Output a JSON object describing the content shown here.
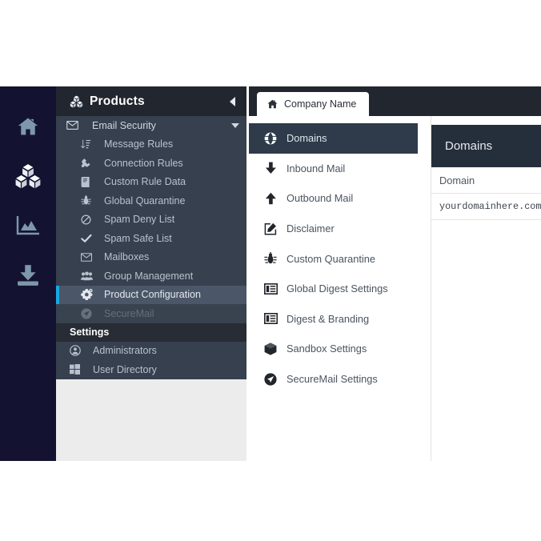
{
  "rail": {
    "items": [
      {
        "name": "home-icon",
        "label": "Home",
        "active": false
      },
      {
        "name": "products-icon",
        "label": "Products",
        "active": true
      },
      {
        "name": "reports-icon",
        "label": "Reports",
        "active": false
      },
      {
        "name": "downloads-icon",
        "label": "Downloads",
        "active": false
      }
    ]
  },
  "products": {
    "title": "Products",
    "collapse_label": "Collapse",
    "group": {
      "label": "Email Security",
      "icon": "envelope-icon",
      "expanded": true
    },
    "items": [
      {
        "label": "Message Rules",
        "icon": "sort-list-icon",
        "state": "normal"
      },
      {
        "label": "Connection Rules",
        "icon": "plug-icon",
        "state": "normal"
      },
      {
        "label": "Custom Rule Data",
        "icon": "book-icon",
        "state": "normal"
      },
      {
        "label": "Global Quarantine",
        "icon": "bug-icon",
        "state": "normal"
      },
      {
        "label": "Spam Deny List",
        "icon": "ban-icon",
        "state": "normal"
      },
      {
        "label": "Spam Safe List",
        "icon": "check-icon",
        "state": "normal"
      },
      {
        "label": "Mailboxes",
        "icon": "envelope-icon",
        "state": "normal"
      },
      {
        "label": "Group Management",
        "icon": "users-icon",
        "state": "normal"
      },
      {
        "label": "Product Configuration",
        "icon": "gears-icon",
        "state": "selected"
      },
      {
        "label": "SecureMail",
        "icon": "paper-plane-icon",
        "state": "disabled"
      }
    ],
    "settings_section": {
      "label": "Settings"
    },
    "settings_items": [
      {
        "label": "Administrators",
        "icon": "user-circle-icon",
        "state": "normal"
      },
      {
        "label": "User Directory",
        "icon": "windows-icon",
        "state": "normal"
      }
    ]
  },
  "tabbar": {
    "tabs": [
      {
        "label": "Company Name",
        "icon": "home-icon",
        "active": true
      }
    ]
  },
  "menu": {
    "items": [
      {
        "label": "Domains",
        "icon": "globe-icon",
        "active": true
      },
      {
        "label": "Inbound Mail",
        "icon": "arrow-down-icon",
        "active": false
      },
      {
        "label": "Outbound Mail",
        "icon": "arrow-up-icon",
        "active": false
      },
      {
        "label": "Disclaimer",
        "icon": "edit-square-icon",
        "active": false
      },
      {
        "label": "Custom Quarantine",
        "icon": "bug-icon",
        "active": false
      },
      {
        "label": "Global Digest Settings",
        "icon": "list-panel-icon",
        "active": false
      },
      {
        "label": "Digest & Branding",
        "icon": "list-panel-icon",
        "active": false
      },
      {
        "label": "Sandbox Settings",
        "icon": "box-icon",
        "active": false
      },
      {
        "label": "SecureMail Settings",
        "icon": "paper-plane-icon",
        "active": false
      }
    ]
  },
  "detail": {
    "title": "Domains",
    "table": {
      "columns": [
        "Domain"
      ],
      "rows": [
        {
          "domain": "yourdomainhere.com"
        }
      ]
    }
  },
  "colors": {
    "rail_bg": "#131331",
    "panel_bg": "#36404e",
    "header_bg": "#22262f",
    "accent": "#16a9e1",
    "selected_bg": "#4b5768",
    "detail_header_bg": "#252f3c",
    "menu_active_bg": "#2f3b4a"
  }
}
